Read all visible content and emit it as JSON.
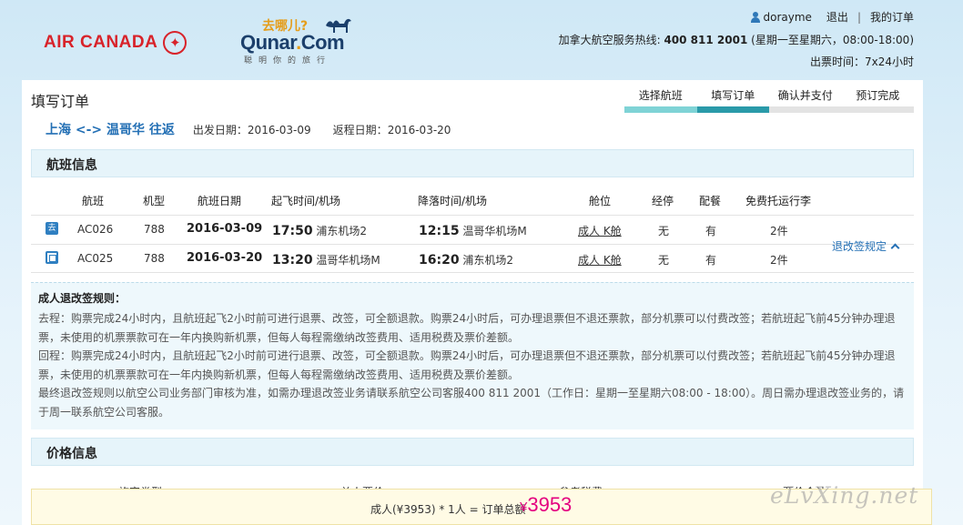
{
  "brand": {
    "airline": "AIR CANADA",
    "qunar_tagline": "去哪儿?",
    "qunar_name": "Qunar",
    "qunar_dot": ".",
    "qunar_com": "Com",
    "qunar_slogan": "聪明你的旅行"
  },
  "user_bar": {
    "username": "dorayme",
    "logout": "退出",
    "separator": "|",
    "my_orders": "我的订单"
  },
  "hotline": {
    "label": "加拿大航空服务热线:",
    "number": "400 811 2001",
    "hours": "(星期一至星期六，08:00-18:00)"
  },
  "ticket_time": "出票时间：7x24小时",
  "page_title": "填写订单",
  "steps": [
    {
      "label": "选择航班",
      "state": "done"
    },
    {
      "label": "填写订单",
      "state": "current"
    },
    {
      "label": "确认并支付",
      "state": "todo"
    },
    {
      "label": "预订完成",
      "state": "todo"
    }
  ],
  "route": {
    "text": "上海 <-> 温哥华 往返",
    "depart_label": "出发日期：",
    "depart_date": "2016-03-09",
    "return_label": "返程日期：",
    "return_date": "2016-03-20"
  },
  "flight_section": {
    "title": "航班信息",
    "headers": [
      "航班",
      "机型",
      "航班日期",
      "起飞时间/机场",
      "降落时间/机场",
      "舱位",
      "经停",
      "配餐",
      "免费托运行李"
    ],
    "rows": [
      {
        "dir": "去",
        "flight": "AC026",
        "model": "788",
        "date": "2016-03-09",
        "dep_time": "17:50",
        "dep_airport": "浦东机场2",
        "arr_time": "12:15",
        "arr_airport": "温哥华机场M",
        "cabin": "成人 K舱",
        "stop": "无",
        "meal": "有",
        "baggage": "2件"
      },
      {
        "dir": "回",
        "flight": "AC025",
        "model": "788",
        "date": "2016-03-20",
        "dep_time": "13:20",
        "dep_airport": "温哥华机场M",
        "arr_time": "16:20",
        "arr_airport": "浦东机场2",
        "cabin": "成人 K舱",
        "stop": "无",
        "meal": "有",
        "baggage": "2件"
      }
    ],
    "rules_link": "退改签规定"
  },
  "rules": {
    "title": "成人退改签规则：",
    "outbound": "去程：购票完成24小时内，且航班起飞2小时前可进行退票、改签，可全额退款。购票24小时后，可办理退票但不退还票款，部分机票可以付费改签；若航班起飞前45分钟办理退票，未使用的机票票款可在一年内换购新机票，但每人每程需缴纳改签费用、适用税费及票价差额。",
    "inbound": "回程：购票完成24小时内，且航班起飞2小时前可进行退票、改签，可全额退款。购票24小时后，可办理退票但不退还票款，部分机票可以付费改签；若航班起飞前45分钟办理退票，未使用的机票票款可在一年内换购新机票，但每人每程需缴纳改签费用、适用税费及票价差额。",
    "final": "最终退改签规则以航空公司业务部门审核为准，如需办理退改签业务请联系航空公司客服400 811 2001（工作日：星期一至星期六08:00 - 18:00）。周日需办理退改签业务的，请于周一联系航空公司客服。"
  },
  "price_section": {
    "title": "价格信息",
    "headers": [
      "旅客类型",
      "单人票价",
      "参考税费",
      "票价合计"
    ]
  },
  "total": {
    "formula": "成人(¥3953) * 1人 = 订单总额",
    "currency": "¥",
    "amount": "3953"
  },
  "watermark": "eLvXing.net"
}
